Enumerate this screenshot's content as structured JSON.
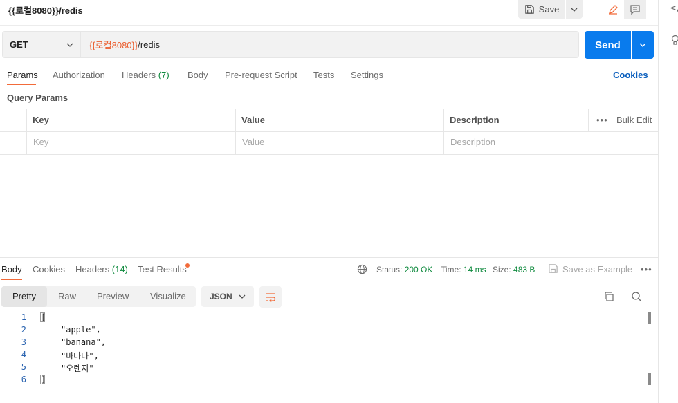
{
  "request_title": "{{로컬8080}}/redis",
  "toolbar": {
    "save_label": "Save"
  },
  "request": {
    "method": "GET",
    "url_var": "{{로컬8080}}",
    "url_path": "/redis",
    "send_label": "Send"
  },
  "request_tabs": [
    {
      "label": "Params"
    },
    {
      "label": "Authorization"
    },
    {
      "label": "Headers",
      "count": "(7)"
    },
    {
      "label": "Body"
    },
    {
      "label": "Pre-request Script"
    },
    {
      "label": "Tests"
    },
    {
      "label": "Settings"
    }
  ],
  "cookies_link": "Cookies",
  "query_params": {
    "title": "Query Params",
    "headers": [
      "Key",
      "Value",
      "Description"
    ],
    "placeholders": [
      "Key",
      "Value",
      "Description"
    ],
    "bulk_edit": "Bulk Edit"
  },
  "response": {
    "tabs": [
      {
        "label": "Body"
      },
      {
        "label": "Cookies"
      },
      {
        "label": "Headers",
        "count": "(14)"
      },
      {
        "label": "Test Results"
      }
    ],
    "status_label": "Status:",
    "status_value": "200 OK",
    "time_label": "Time:",
    "time_value": "14 ms",
    "size_label": "Size:",
    "size_value": "483 B",
    "save_example": "Save as Example",
    "views": [
      "Pretty",
      "Raw",
      "Preview",
      "Visualize"
    ],
    "format": "JSON",
    "line_numbers": [
      "1",
      "2",
      "3",
      "4",
      "5",
      "6"
    ],
    "body_lines": [
      "[",
      "\"apple\",",
      "\"banana\",",
      "\"바나나\",",
      "\"오렌지\"",
      "]"
    ]
  },
  "colors": {
    "accent": "#f26b3a",
    "send": "#097bed",
    "link": "#0b5fbd",
    "ok": "#0f8a3e"
  }
}
